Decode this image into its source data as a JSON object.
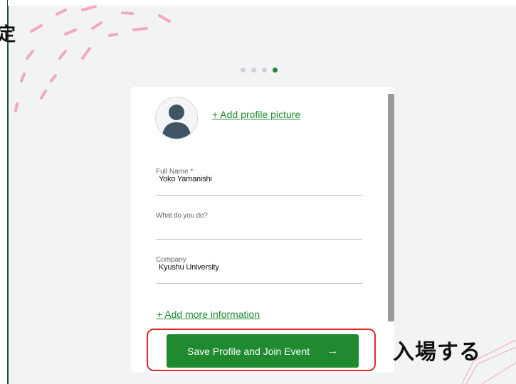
{
  "side": {
    "cut_text": "定"
  },
  "progress": {
    "steps": 4,
    "active_step": 4
  },
  "profile": {
    "add_picture_label": "+ Add profile picture",
    "fields": {
      "full_name": {
        "label": "Full Name *",
        "value": "Yoko Yamanishi"
      },
      "what_do_you_do": {
        "label": "",
        "placeholder": "What do you do?",
        "value": ""
      },
      "company": {
        "label": "Company",
        "value": "Kyushu University"
      }
    },
    "add_more_label": "+ Add more information",
    "save_button_label": "Save Profile and Join Event",
    "save_button_arrow": "→"
  },
  "annotation": {
    "enter_label": "入場する",
    "highlight_color": "#e12a2a"
  },
  "colors": {
    "accent": "#1f8a2f",
    "background": "#f2f3f4",
    "decoration": "#f4a6c3"
  },
  "icons": {
    "avatar": "person-silhouette-icon",
    "arrow": "arrow-right-icon"
  }
}
